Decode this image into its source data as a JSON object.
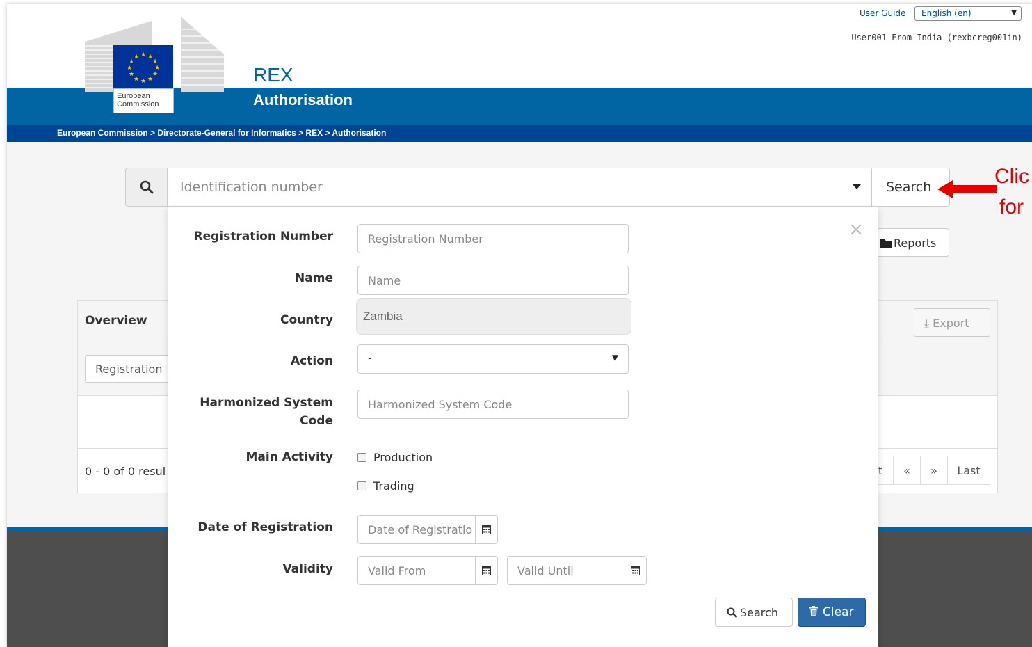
{
  "header": {
    "user_guide": "User Guide",
    "language": "English (en)",
    "user_info": "User001 From India (rexbcreg001in)",
    "logo_line1": "European",
    "logo_line2": "Commission",
    "site_title": "REX",
    "site_subtitle": "Authorisation",
    "breadcrumb": "European Commission > Directorate-General for Informatics > REX > Authorisation"
  },
  "search": {
    "placeholder": "Identification number",
    "button": "Search"
  },
  "annotation": {
    "line1": "Clic",
    "line2": "for"
  },
  "background": {
    "reports": "Reports",
    "overview_title": "Overview",
    "export": "Export",
    "registration_col": "Registration",
    "results": "0 - 0 of 0 resul",
    "pager_next": "t",
    "pager_prev": "«",
    "pager_forward": "»",
    "pager_last": "Last"
  },
  "advanced": {
    "close": "×",
    "registration_number_label": "Registration Number",
    "registration_number_placeholder": "Registration Number",
    "name_label": "Name",
    "name_placeholder": "Name",
    "country_label": "Country",
    "country_value": "Zambia",
    "action_label": "Action",
    "action_value": "-",
    "hs_label_line1": "Harmonized System",
    "hs_label_line2": "Code",
    "hs_placeholder": "Harmonized System Code",
    "main_activity_label": "Main Activity",
    "production": "Production",
    "trading": "Trading",
    "date_label": "Date of Registration",
    "date_placeholder": "Date of Registratio",
    "validity_label": "Validity",
    "valid_from_placeholder": "Valid From",
    "valid_until_placeholder": "Valid Until",
    "search_button": "Search",
    "clear_button": "Clear"
  },
  "colors": {
    "brand_blue": "#0065a2",
    "breadcrumb_blue": "#004494",
    "clear_button": "#2d6aa8",
    "annotation_red": "#e60000"
  }
}
